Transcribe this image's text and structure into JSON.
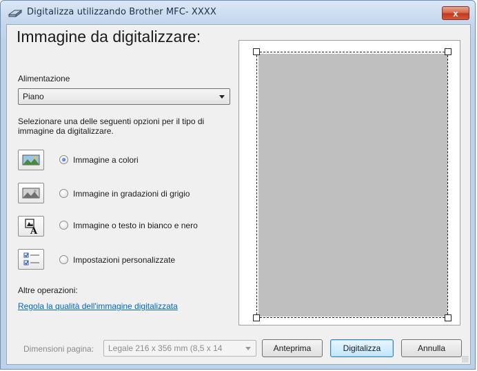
{
  "window": {
    "title": "Digitalizza utilizzando Brother MFC- XXXX",
    "close_symbol": "x"
  },
  "main": {
    "heading": "Immagine da digitalizzare:",
    "source_label": "Alimentazione",
    "source_value": "Piano",
    "description": "Selezionare una delle seguenti opzioni per il tipo di immagine da digitalizzare.",
    "options": [
      {
        "label": "Immagine a colori",
        "checked": true,
        "icon": "color-picture-icon"
      },
      {
        "label": "Immagine in gradazioni di grigio",
        "checked": false,
        "icon": "grayscale-picture-icon"
      },
      {
        "label": "Immagine o testo in bianco e nero",
        "checked": false,
        "icon": "black-white-text-icon"
      },
      {
        "label": "Impostazioni personalizzate",
        "checked": false,
        "icon": "custom-settings-icon"
      }
    ],
    "other_label": "Altre operazioni:",
    "quality_link": "Regola la qualità dell'immagine digitalizzata"
  },
  "bottom": {
    "page_size_label": "Dimensioni pagina:",
    "page_size_value": "Legale 216 x 356 mm (8,5 x 14",
    "preview_button": "Anteprima",
    "scan_button": "Digitalizza",
    "cancel_button": "Annulla"
  },
  "colors": {
    "link": "#0066cc",
    "preview_page": "#bfbfbf",
    "close_button": "#c2391b"
  }
}
